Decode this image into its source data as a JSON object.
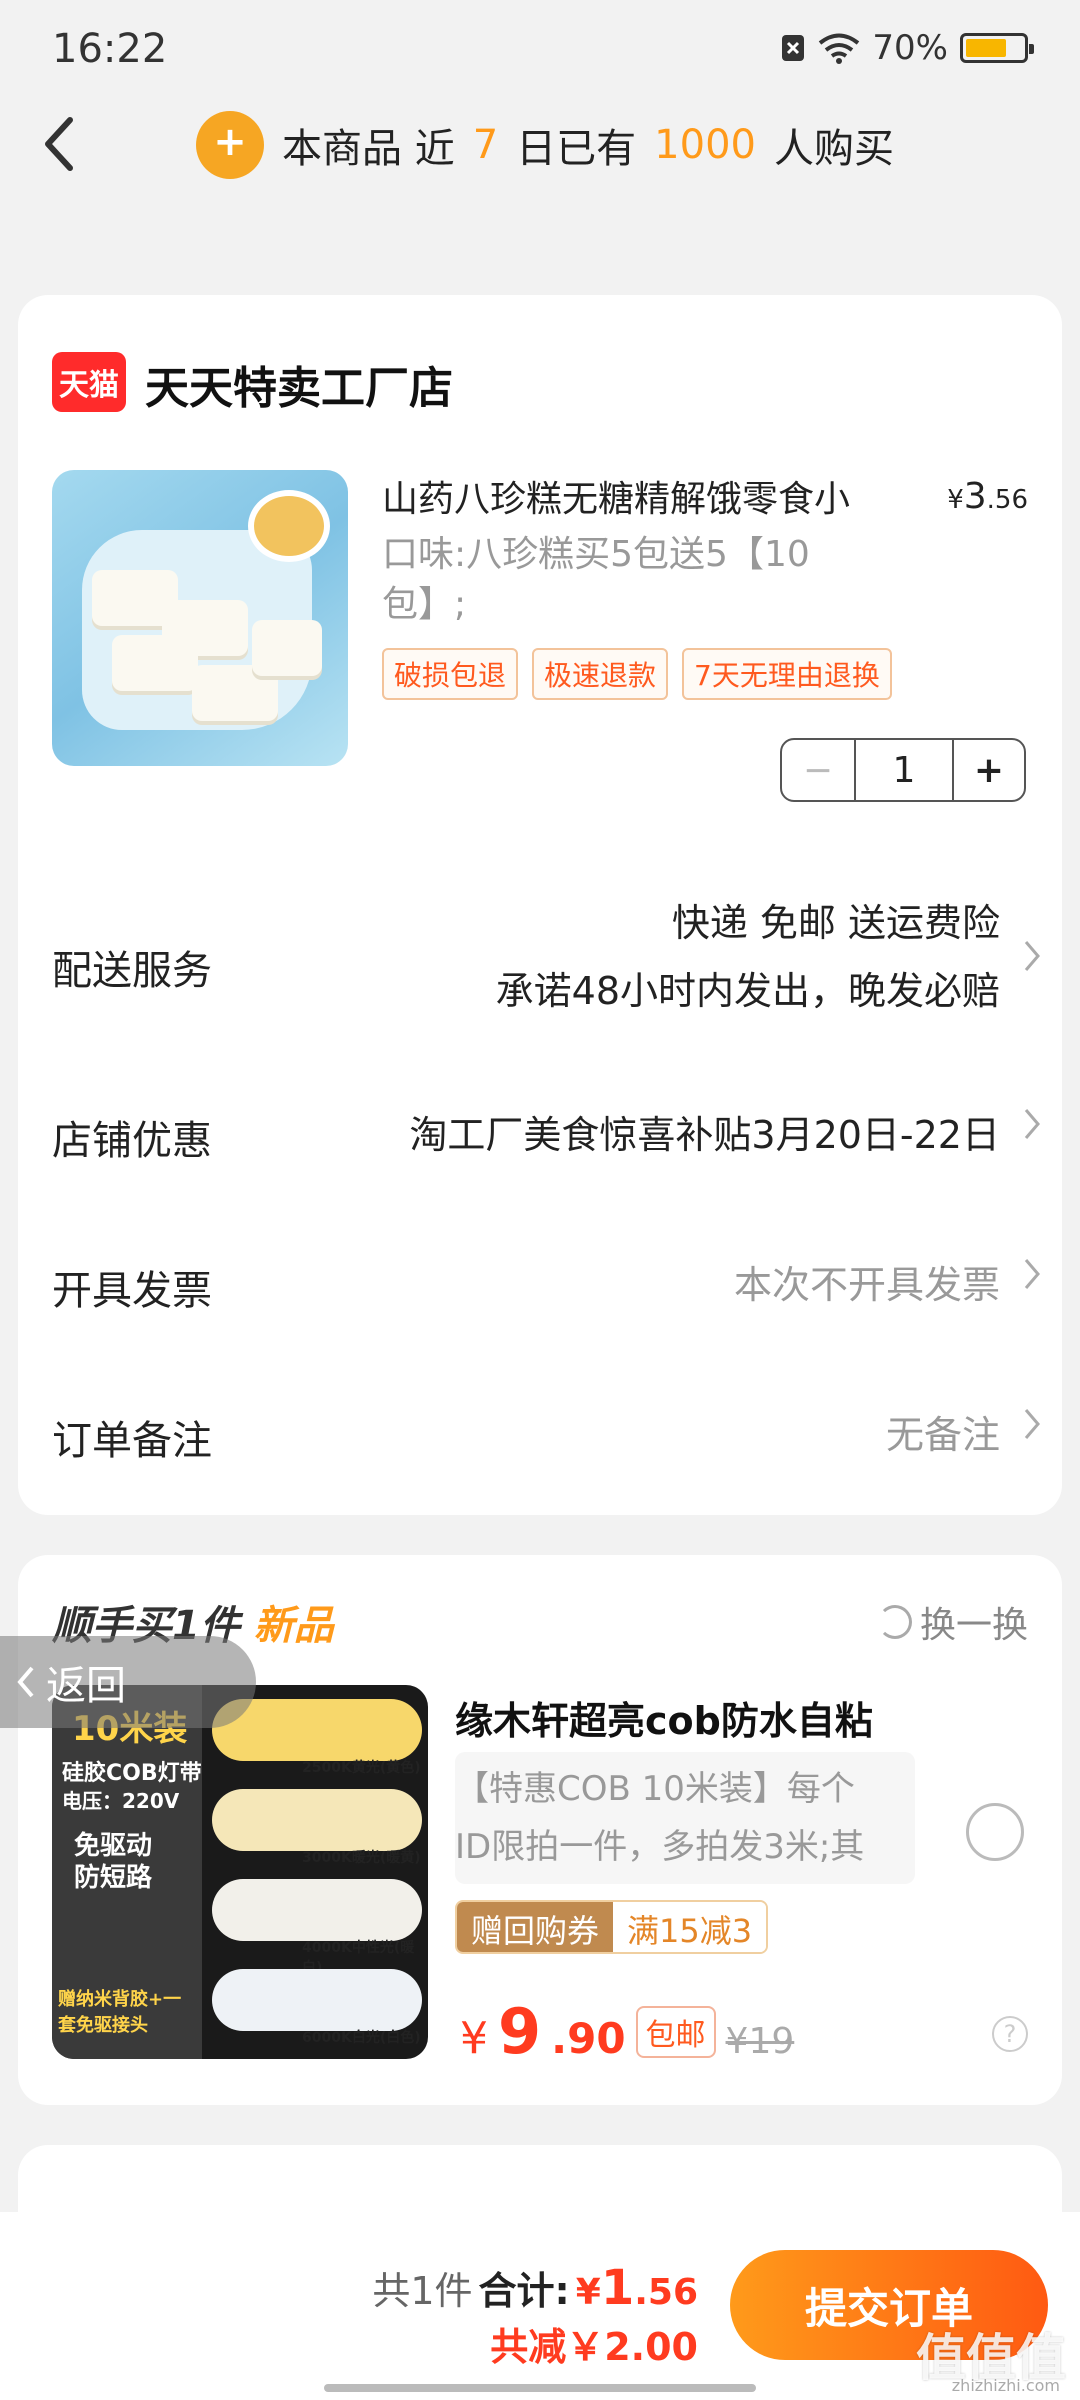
{
  "status_bar": {
    "time": "16:22",
    "battery": "70%",
    "battery_level": 0.7
  },
  "header": {
    "banner": {
      "prefix": "本商品 近",
      "days": "7",
      "middle": "日已有",
      "count": "1000",
      "suffix": "人购买"
    }
  },
  "shop": {
    "badge": "天猫",
    "name": "天天特卖工厂店",
    "product": {
      "title": "山药八珍糕无糖精解饿零食小",
      "price_symbol": "¥",
      "price_int": "3",
      "price_dec": ".56",
      "spec": "口味:八珍糕买5包送5【10包】;",
      "tags": [
        "破损包退",
        "极速退款",
        "7天无理由退换"
      ],
      "stepper": {
        "minus": "−",
        "qty": "1",
        "plus": "+"
      }
    },
    "rows": {
      "delivery": {
        "label": "配送服务",
        "line1": "快递 免邮 送运费险",
        "line2": "承诺48小时内发出，晚发必赔"
      },
      "promo": {
        "label": "店铺优惠",
        "value": "淘工厂美食惊喜补贴3月20日-22日"
      },
      "invoice": {
        "label": "开具发票",
        "value": "本次不开具发票"
      },
      "note": {
        "label": "订单备注",
        "value": "无备注"
      }
    }
  },
  "recommend": {
    "title_a": "顺手买1件",
    "title_b": "新品",
    "swap": "换一换",
    "return_label": "返回",
    "product": {
      "image_text": {
        "head": "10米装",
        "line1": "硅胶COB灯带",
        "line2": "电压：220V",
        "line3": "免驱动",
        "line4": "防短路",
        "bottom": "赠纳米背胶+一套免驱接头",
        "s1": "2500K黄光(黄色)",
        "s2": "3000K暖光(暖黄)",
        "s3": "4000K中性光(暖白)",
        "s4": "6000K白光(白色)"
      },
      "name": "缘木轩超亮cob防水自粘",
      "desc1": "【特惠COB 10米装】每个",
      "desc2": "ID限拍一件，多拍发3米;其",
      "coupon_left": "赠回购券",
      "coupon_right": "满15减3",
      "price_symbol": "¥",
      "price_int": "9",
      "price_dec": ".90",
      "shipping": "包邮",
      "old_price": "¥19"
    }
  },
  "footer": {
    "count": "共1件",
    "total_label": "合计:",
    "total_symbol": "¥",
    "total_int": "1",
    "total_dec": ".56",
    "savings": "共减￥2.00",
    "submit": "提交订单",
    "watermark": "值值值",
    "watermark_url": "zhizhizhi.com"
  },
  "colors": {
    "accent": "#ff9a1a",
    "price": "#ff3b1f",
    "tmall": "#ff2b2b"
  }
}
